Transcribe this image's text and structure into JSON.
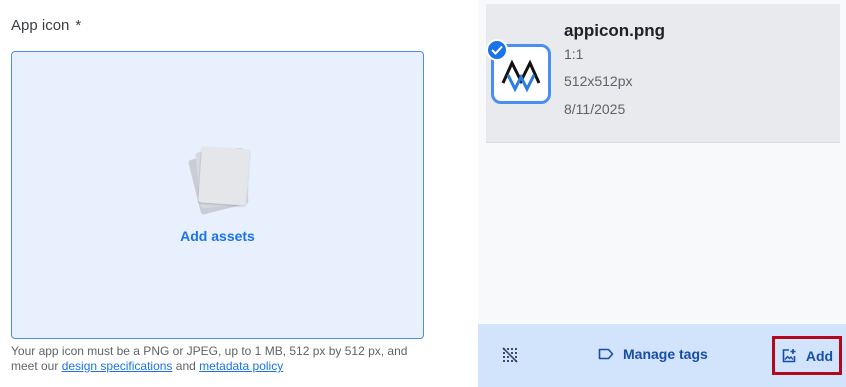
{
  "field": {
    "label": "App icon",
    "required_mark": "*"
  },
  "dropzone": {
    "action_label": "Add assets"
  },
  "help": {
    "text": "Your app icon must be a PNG or JPEG, up to 1 MB, 512 px by 512 px, and meet our",
    "link1": "design specifications",
    "joiner": "and",
    "link2": "metadata policy"
  },
  "asset": {
    "name": "appicon.png",
    "ratio": "1:1",
    "dimensions": "512x512px",
    "date": "8/11/2025",
    "selected": true
  },
  "bottom_bar": {
    "unselect_icon": "grid-off-icon",
    "manage_tags_label": "Manage tags",
    "add_label": "Add"
  },
  "colors": {
    "accent": "#1a73e8",
    "dropzone_bg": "#e8f0fe",
    "bar_bg": "#d2e3fc",
    "highlight": "#b3081a"
  }
}
